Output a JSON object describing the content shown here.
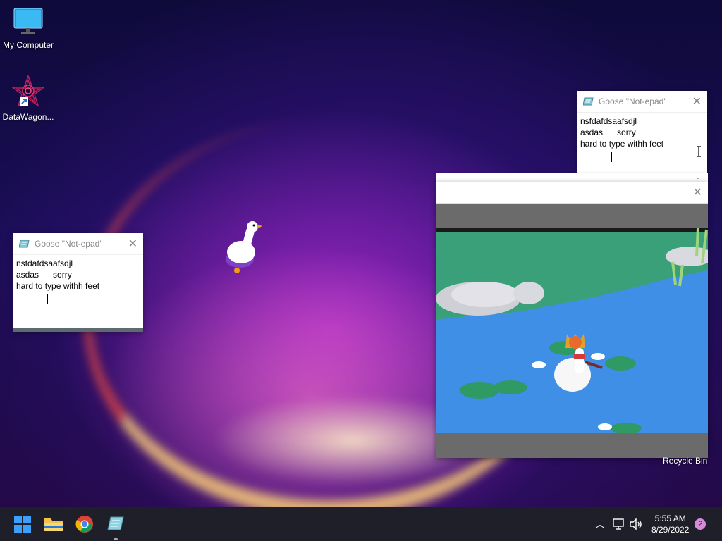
{
  "desktop": {
    "icons": [
      {
        "label": "My Computer"
      },
      {
        "label": "DataWagon..."
      }
    ],
    "recycle_bin_label": "Recycle Bin"
  },
  "notepad_windows": [
    {
      "title": "Goose \"Not-epad\"",
      "lines": [
        "nsfdafdsaafsdjl",
        "asdas      sorry",
        "hard to type withh feet"
      ]
    },
    {
      "title": "Goose \"Not-epad\"",
      "lines": [
        "nsfdafdsaafsdjl",
        "asdas      sorry",
        "hard to type withh feet"
      ]
    }
  ],
  "game_window": {
    "title": ""
  },
  "taskbar": {
    "apps": [
      "start-icon",
      "file-explorer-icon",
      "chrome-icon",
      "notepad-icon"
    ],
    "clock_time": "5:55 AM",
    "clock_date": "8/29/2022",
    "notification_count": "2"
  },
  "colors": {
    "water": "#3f8fe6",
    "grass": "#3aa07a",
    "taskbar": "#1f1f2a"
  }
}
